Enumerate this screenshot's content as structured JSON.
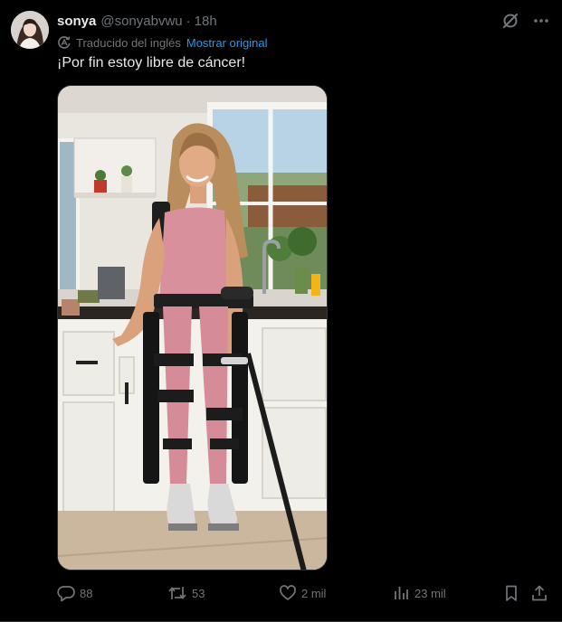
{
  "author": {
    "name": "sonya",
    "handle": "@sonyabvwu",
    "separator": "·",
    "time": "18h",
    "avatar_icon": "avatar-photo"
  },
  "translation": {
    "note": "Traducido del inglés",
    "show_original": "Mostrar original",
    "icon": "translate-icon"
  },
  "tweet": {
    "text": "¡Por fin estoy libre de cáncer!",
    "media_icon": "photo-woman-exoskeleton-kitchen"
  },
  "top_actions": {
    "grok_icon": "grok-icon",
    "more_icon": "more-icon"
  },
  "metrics": {
    "replies": "88",
    "reposts": "53",
    "likes": "2 mil",
    "views": "23 mil"
  },
  "colors": {
    "background": "#000000",
    "text": "#e7e9ea",
    "muted": "#71767b",
    "link": "#1d9bf0",
    "border": "#2f3336"
  }
}
